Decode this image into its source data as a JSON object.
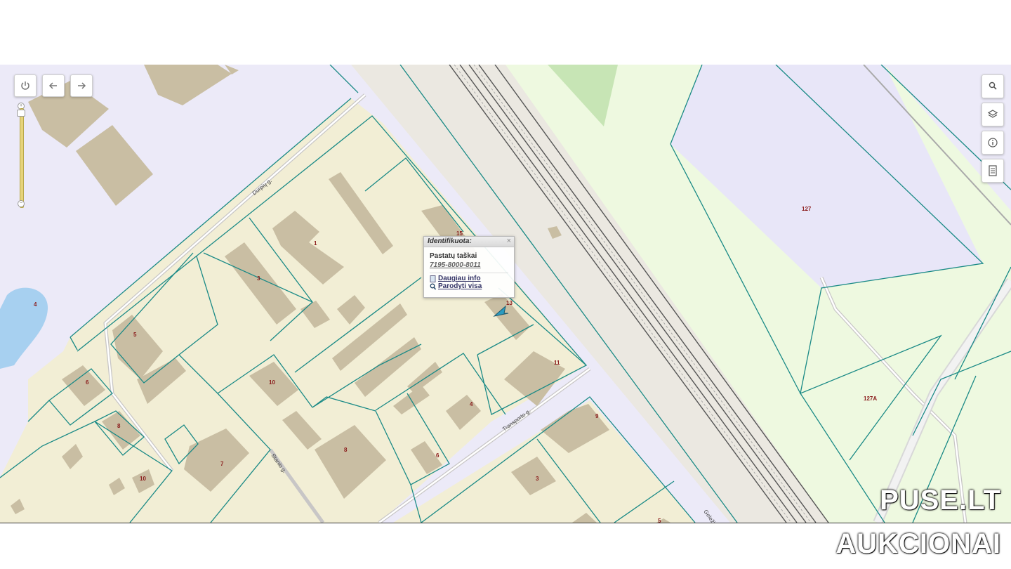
{
  "map": {
    "streets": [
      {
        "key": "durpiu",
        "label": "Durpių g."
      },
      {
        "key": "transporto",
        "label": "Transporto g."
      },
      {
        "key": "stanio",
        "label": "Staniо g."
      },
      {
        "key": "gelez",
        "label": "Geležinkelio g."
      }
    ],
    "parcel_labels": [
      "1",
      "3",
      "4",
      "5",
      "6",
      "8",
      "10",
      "7",
      "8",
      "10",
      "6",
      "4",
      "11",
      "13",
      "15",
      "9",
      "3",
      "5",
      "127",
      "127A"
    ],
    "colors": {
      "parcel_fill": "#f2eed5",
      "building_fill": "#c9bea3",
      "boundary": "#1a8a86",
      "background": "#eceaf8",
      "green": "#eef9e0",
      "water": "#a7d0f0",
      "label": "#8a1a1a"
    }
  },
  "controls": {
    "top_left": [
      {
        "name": "power-button",
        "icon": "power-icon"
      },
      {
        "name": "back-button",
        "icon": "arrow-left-icon"
      },
      {
        "name": "forward-button",
        "icon": "arrow-right-icon"
      }
    ],
    "right": [
      {
        "name": "search-button",
        "icon": "search-icon"
      },
      {
        "name": "layers-button",
        "icon": "layers-icon"
      },
      {
        "name": "info-button",
        "icon": "info-icon"
      },
      {
        "name": "legend-button",
        "icon": "document-icon"
      }
    ],
    "zoom": {
      "plus": "+",
      "minus": "−"
    }
  },
  "popup": {
    "header": "Identifikuota:",
    "close": "×",
    "title": "Pastatų taškai",
    "code": "7195-8000-8011",
    "link_more": "Daugiau info",
    "link_show_all": "Parodyti visa"
  },
  "watermark": {
    "line1": "PUSE.LT",
    "line2": "AUKCIONAI"
  }
}
